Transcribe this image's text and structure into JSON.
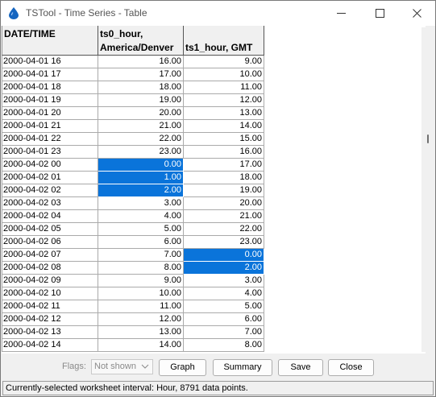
{
  "window": {
    "title": "TSTool - Time Series - Table"
  },
  "table": {
    "headers": [
      {
        "line1": "DATE/TIME",
        "line2": ""
      },
      {
        "line1": "ts0_hour,",
        "line2": "America/Denver"
      },
      {
        "line1": "",
        "line2": "ts1_hour, GMT"
      }
    ],
    "rows": [
      {
        "date": "2000-04-01 16",
        "ts0": "16.00",
        "ts1": "9.00",
        "sel0": false,
        "sel1": false
      },
      {
        "date": "2000-04-01 17",
        "ts0": "17.00",
        "ts1": "10.00",
        "sel0": false,
        "sel1": false
      },
      {
        "date": "2000-04-01 18",
        "ts0": "18.00",
        "ts1": "11.00",
        "sel0": false,
        "sel1": false
      },
      {
        "date": "2000-04-01 19",
        "ts0": "19.00",
        "ts1": "12.00",
        "sel0": false,
        "sel1": false
      },
      {
        "date": "2000-04-01 20",
        "ts0": "20.00",
        "ts1": "13.00",
        "sel0": false,
        "sel1": false
      },
      {
        "date": "2000-04-01 21",
        "ts0": "21.00",
        "ts1": "14.00",
        "sel0": false,
        "sel1": false
      },
      {
        "date": "2000-04-01 22",
        "ts0": "22.00",
        "ts1": "15.00",
        "sel0": false,
        "sel1": false
      },
      {
        "date": "2000-04-01 23",
        "ts0": "23.00",
        "ts1": "16.00",
        "sel0": false,
        "sel1": false
      },
      {
        "date": "2000-04-02 00",
        "ts0": "0.00",
        "ts1": "17.00",
        "sel0": true,
        "sel1": false
      },
      {
        "date": "2000-04-02 01",
        "ts0": "1.00",
        "ts1": "18.00",
        "sel0": true,
        "sel1": false
      },
      {
        "date": "2000-04-02 02",
        "ts0": "2.00",
        "ts1": "19.00",
        "sel0": true,
        "sel1": false
      },
      {
        "date": "2000-04-02 03",
        "ts0": "3.00",
        "ts1": "20.00",
        "sel0": false,
        "sel1": false
      },
      {
        "date": "2000-04-02 04",
        "ts0": "4.00",
        "ts1": "21.00",
        "sel0": false,
        "sel1": false
      },
      {
        "date": "2000-04-02 05",
        "ts0": "5.00",
        "ts1": "22.00",
        "sel0": false,
        "sel1": false
      },
      {
        "date": "2000-04-02 06",
        "ts0": "6.00",
        "ts1": "23.00",
        "sel0": false,
        "sel1": false
      },
      {
        "date": "2000-04-02 07",
        "ts0": "7.00",
        "ts1": "0.00",
        "sel0": false,
        "sel1": true
      },
      {
        "date": "2000-04-02 08",
        "ts0": "8.00",
        "ts1": "2.00",
        "sel0": false,
        "sel1": true
      },
      {
        "date": "2000-04-02 09",
        "ts0": "9.00",
        "ts1": "3.00",
        "sel0": false,
        "sel1": false
      },
      {
        "date": "2000-04-02 10",
        "ts0": "10.00",
        "ts1": "4.00",
        "sel0": false,
        "sel1": false
      },
      {
        "date": "2000-04-02 11",
        "ts0": "11.00",
        "ts1": "5.00",
        "sel0": false,
        "sel1": false
      },
      {
        "date": "2000-04-02 12",
        "ts0": "12.00",
        "ts1": "6.00",
        "sel0": false,
        "sel1": false
      },
      {
        "date": "2000-04-02 13",
        "ts0": "13.00",
        "ts1": "7.00",
        "sel0": false,
        "sel1": false
      },
      {
        "date": "2000-04-02 14",
        "ts0": "14.00",
        "ts1": "8.00",
        "sel0": false,
        "sel1": false
      }
    ]
  },
  "toolbar": {
    "flags_label": "Flags:",
    "flags_value": "Not shown",
    "graph_label": "Graph",
    "summary_label": "Summary",
    "save_label": "Save",
    "close_label": "Close"
  },
  "status": {
    "text": "Currently-selected worksheet interval: Hour, 8791 data points."
  },
  "colors": {
    "selection": "#0a74da",
    "app_icon": "#1565c0"
  }
}
